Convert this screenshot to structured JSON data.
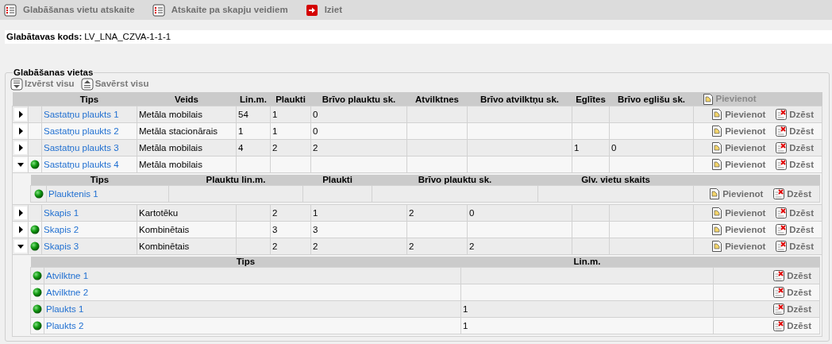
{
  "toolbar": [
    {
      "kind": "report",
      "label": "Glabāšanas vietu atskaite"
    },
    {
      "kind": "report",
      "label": "Atskaite pa skapju veidiem"
    },
    {
      "kind": "exit",
      "label": "Iziet"
    }
  ],
  "storage_code": {
    "label": "Glabātavas kods:",
    "value": "LV_LNA_CZVA-1-1-1"
  },
  "places": {
    "title": "Glabāšanas vietas",
    "expand_all": "Izvērst visu",
    "collapse_all": "Savērst visu",
    "columns": [
      "Tips",
      "Veids",
      "Lin.m.",
      "Plaukti",
      "Brīvo plauktu sk.",
      "Atvilktnes",
      "Brīvo atvilktņu sk.",
      "Eglītes",
      "Brīvo eglišu sk."
    ],
    "header_action": {
      "kind": "add",
      "label": "Pievienot"
    },
    "rows": [
      {
        "expanded": false,
        "marked": false,
        "cells": [
          "Sastatņu plaukts 1",
          "Metāla mobilais",
          "54",
          "1",
          "0",
          null,
          null,
          null,
          null
        ],
        "actions": [
          {
            "kind": "add",
            "label": "Pievienot"
          },
          {
            "kind": "delete",
            "label": "Dzēst"
          }
        ]
      },
      {
        "expanded": false,
        "marked": false,
        "cells": [
          "Sastatņu plaukts 2",
          "Metāla stacionārais",
          "1",
          "1",
          "0",
          null,
          null,
          null,
          null
        ],
        "actions": [
          {
            "kind": "add",
            "label": "Pievienot"
          },
          {
            "kind": "delete",
            "label": "Dzēst"
          }
        ]
      },
      {
        "expanded": false,
        "marked": false,
        "cells": [
          "Sastatņu plaukts 3",
          "Metāla mobilais",
          "4",
          "2",
          "2",
          null,
          null,
          "1",
          "0"
        ],
        "actions": [
          {
            "kind": "add",
            "label": "Pievienot"
          },
          {
            "kind": "delete",
            "label": "Dzēst"
          }
        ]
      },
      {
        "expanded": true,
        "marked": true,
        "cells": [
          "Sastatņu plaukts 4",
          "Metāla mobilais",
          null,
          null,
          null,
          null,
          null,
          null,
          null
        ],
        "actions": [
          {
            "kind": "add",
            "label": "Pievienot"
          },
          {
            "kind": "delete",
            "label": "Dzēst"
          }
        ],
        "children": {
          "kind": "shelf",
          "columns": [
            "Tips",
            "Plauktu lin.m.",
            "Plaukti",
            "Brīvo plauktu sk.",
            "Glv. vietu skaits"
          ],
          "rows": [
            {
              "marked": true,
              "cells": [
                "Plauktenis 1",
                null,
                null,
                null,
                null
              ],
              "actions": [
                {
                  "kind": "add",
                  "label": "Pievienot"
                },
                {
                  "kind": "delete",
                  "label": "Dzēst"
                }
              ]
            }
          ]
        }
      },
      {
        "expanded": false,
        "marked": false,
        "cells": [
          "Skapis 1",
          "Kartotēku",
          null,
          "2",
          "1",
          "2",
          "0",
          null,
          null
        ],
        "actions": [
          {
            "kind": "add",
            "label": "Pievienot"
          },
          {
            "kind": "delete",
            "label": "Dzēst"
          }
        ]
      },
      {
        "expanded": false,
        "marked": true,
        "cells": [
          "Skapis 2",
          "Kombinētais",
          null,
          "3",
          "3",
          null,
          null,
          null,
          null
        ],
        "actions": [
          {
            "kind": "add",
            "label": "Pievienot"
          },
          {
            "kind": "delete",
            "label": "Dzēst"
          }
        ]
      },
      {
        "expanded": true,
        "marked": true,
        "cells": [
          "Skapis 3",
          "Kombinētais",
          null,
          "2",
          "2",
          "2",
          "2",
          null,
          null
        ],
        "actions": [
          {
            "kind": "add",
            "label": "Pievienot"
          },
          {
            "kind": "delete",
            "label": "Dzēst"
          }
        ],
        "children": {
          "kind": "drawer",
          "columns": [
            "Tips",
            "Lin.m."
          ],
          "rows": [
            {
              "marked": true,
              "cells": [
                "Atvilktne 1",
                null
              ],
              "actions": [
                {
                  "kind": "delete",
                  "label": "Dzēst"
                }
              ]
            },
            {
              "marked": true,
              "cells": [
                "Atvilktne 2",
                null
              ],
              "actions": [
                {
                  "kind": "delete",
                  "label": "Dzēst"
                }
              ]
            },
            {
              "marked": true,
              "cells": [
                "Plaukts 1",
                "1"
              ],
              "actions": [
                {
                  "kind": "delete",
                  "label": "Dzēst"
                }
              ]
            },
            {
              "marked": true,
              "cells": [
                "Plaukts 2",
                "1"
              ],
              "actions": [
                {
                  "kind": "delete",
                  "label": "Dzēst"
                }
              ]
            }
          ]
        }
      }
    ]
  }
}
